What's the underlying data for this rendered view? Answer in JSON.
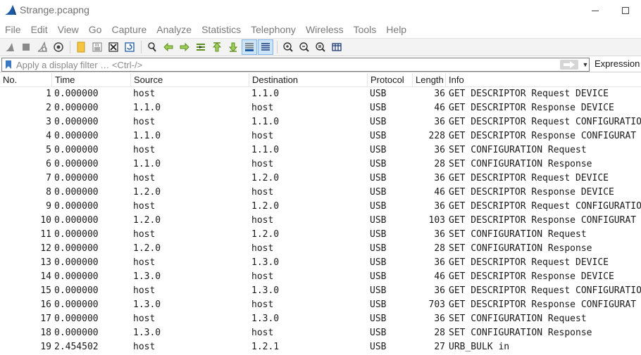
{
  "window": {
    "title": "Strange.pcapng"
  },
  "menu": [
    "File",
    "Edit",
    "View",
    "Go",
    "Capture",
    "Analyze",
    "Statistics",
    "Telephony",
    "Wireless",
    "Tools",
    "Help"
  ],
  "toolbar": {
    "icons": [
      "start-capture-icon",
      "stop-capture-icon",
      "restart-capture-icon",
      "capture-options-icon",
      "open-file-icon",
      "save-file-icon",
      "close-file-icon",
      "reload-file-icon",
      "find-packet-icon",
      "go-back-icon",
      "go-forward-icon",
      "go-to-packet-icon",
      "first-packet-icon",
      "last-packet-icon",
      "autoscroll-icon",
      "colorize-icon",
      "zoom-in-icon",
      "zoom-out-icon",
      "zoom-normal-icon",
      "resize-columns-icon"
    ]
  },
  "filter": {
    "placeholder": "Apply a display filter … <Ctrl-/>",
    "value": "",
    "expression_label": "Expression"
  },
  "columns": {
    "no": "No.",
    "time": "Time",
    "source": "Source",
    "destination": "Destination",
    "protocol": "Protocol",
    "length": "Length",
    "info": "Info"
  },
  "packets": [
    {
      "no": "1",
      "time": "0.000000",
      "source": "host",
      "destination": "1.1.0",
      "protocol": "USB",
      "length": "36",
      "info": "GET DESCRIPTOR Request DEVICE"
    },
    {
      "no": "2",
      "time": "0.000000",
      "source": "1.1.0",
      "destination": "host",
      "protocol": "USB",
      "length": "46",
      "info": "GET DESCRIPTOR Response DEVICE"
    },
    {
      "no": "3",
      "time": "0.000000",
      "source": "host",
      "destination": "1.1.0",
      "protocol": "USB",
      "length": "36",
      "info": "GET DESCRIPTOR Request CONFIGURATIO"
    },
    {
      "no": "4",
      "time": "0.000000",
      "source": "1.1.0",
      "destination": "host",
      "protocol": "USB",
      "length": "228",
      "info": "GET DESCRIPTOR Response CONFIGURAT"
    },
    {
      "no": "5",
      "time": "0.000000",
      "source": "host",
      "destination": "1.1.0",
      "protocol": "USB",
      "length": "36",
      "info": "SET CONFIGURATION Request"
    },
    {
      "no": "6",
      "time": "0.000000",
      "source": "1.1.0",
      "destination": "host",
      "protocol": "USB",
      "length": "28",
      "info": "SET CONFIGURATION Response"
    },
    {
      "no": "7",
      "time": "0.000000",
      "source": "host",
      "destination": "1.2.0",
      "protocol": "USB",
      "length": "36",
      "info": "GET DESCRIPTOR Request DEVICE"
    },
    {
      "no": "8",
      "time": "0.000000",
      "source": "1.2.0",
      "destination": "host",
      "protocol": "USB",
      "length": "46",
      "info": "GET DESCRIPTOR Response DEVICE"
    },
    {
      "no": "9",
      "time": "0.000000",
      "source": "host",
      "destination": "1.2.0",
      "protocol": "USB",
      "length": "36",
      "info": "GET DESCRIPTOR Request CONFIGURATIO"
    },
    {
      "no": "10",
      "time": "0.000000",
      "source": "1.2.0",
      "destination": "host",
      "protocol": "USB",
      "length": "103",
      "info": "GET DESCRIPTOR Response CONFIGURAT"
    },
    {
      "no": "11",
      "time": "0.000000",
      "source": "host",
      "destination": "1.2.0",
      "protocol": "USB",
      "length": "36",
      "info": "SET CONFIGURATION Request"
    },
    {
      "no": "12",
      "time": "0.000000",
      "source": "1.2.0",
      "destination": "host",
      "protocol": "USB",
      "length": "28",
      "info": "SET CONFIGURATION Response"
    },
    {
      "no": "13",
      "time": "0.000000",
      "source": "host",
      "destination": "1.3.0",
      "protocol": "USB",
      "length": "36",
      "info": "GET DESCRIPTOR Request DEVICE"
    },
    {
      "no": "14",
      "time": "0.000000",
      "source": "1.3.0",
      "destination": "host",
      "protocol": "USB",
      "length": "46",
      "info": "GET DESCRIPTOR Response DEVICE"
    },
    {
      "no": "15",
      "time": "0.000000",
      "source": "host",
      "destination": "1.3.0",
      "protocol": "USB",
      "length": "36",
      "info": "GET DESCRIPTOR Request CONFIGURATIO"
    },
    {
      "no": "16",
      "time": "0.000000",
      "source": "1.3.0",
      "destination": "host",
      "protocol": "USB",
      "length": "703",
      "info": "GET DESCRIPTOR Response CONFIGURAT"
    },
    {
      "no": "17",
      "time": "0.000000",
      "source": "host",
      "destination": "1.3.0",
      "protocol": "USB",
      "length": "36",
      "info": "SET CONFIGURATION Request"
    },
    {
      "no": "18",
      "time": "0.000000",
      "source": "1.3.0",
      "destination": "host",
      "protocol": "USB",
      "length": "28",
      "info": "SET CONFIGURATION Response"
    },
    {
      "no": "19",
      "time": "2.454502",
      "source": "host",
      "destination": "1.2.1",
      "protocol": "USB",
      "length": "27",
      "info": "URB_BULK in"
    }
  ],
  "colors": {
    "accent_blue": "#1c5aa8",
    "toolbar_active": "#cce4f7"
  }
}
